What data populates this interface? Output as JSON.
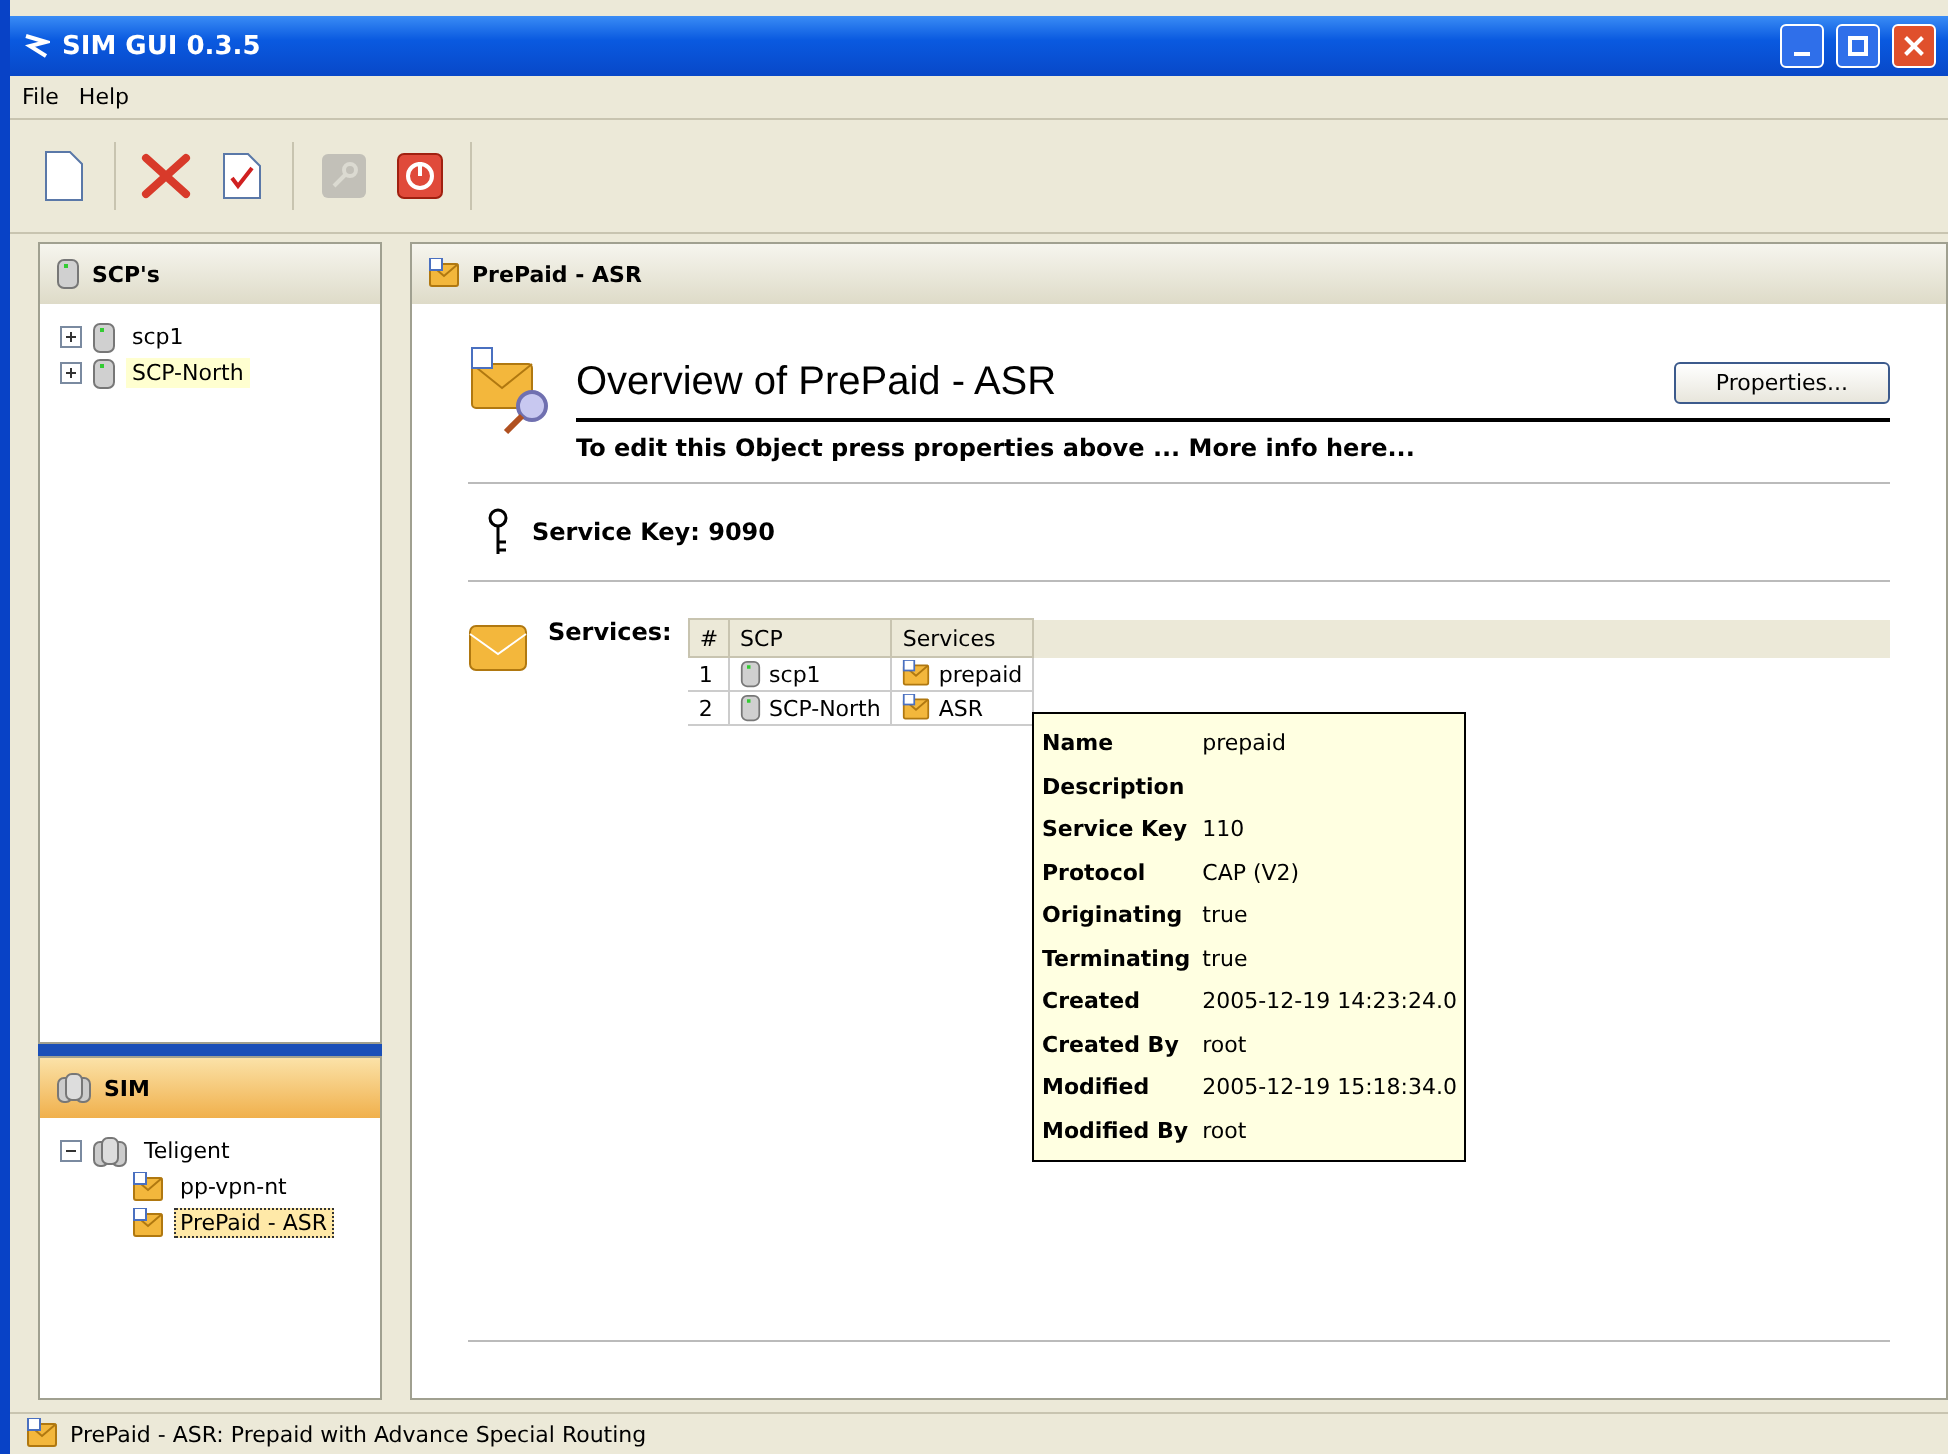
{
  "window": {
    "title": "SIM GUI 0.3.5"
  },
  "menu": [
    "File",
    "Help"
  ],
  "toolbar": [
    {
      "disabled": false
    },
    {
      "disabled": false
    },
    {
      "disabled": false
    },
    {
      "disabled": true
    },
    {
      "disabled": false
    }
  ],
  "scp_panel": {
    "title": "SCP's",
    "items": [
      {
        "label": "scp1",
        "expanded": false,
        "highlighted": false
      },
      {
        "label": "SCP-North",
        "expanded": false,
        "highlighted": true
      }
    ]
  },
  "sim_panel": {
    "title": "SIM",
    "items": [
      {
        "label": "Teligent",
        "expanded": true,
        "selected": false,
        "children": [
          {
            "label": "pp-vpn-nt",
            "selected": false
          },
          {
            "label": "PrePaid - ASR",
            "selected": true
          }
        ]
      }
    ]
  },
  "content": {
    "tab_title": "PrePaid - ASR",
    "heading": "Overview of PrePaid - ASR",
    "properties_button": "Properties...",
    "hint": "To edit this Object press properties above ... More info here...",
    "service_key": "Service Key: 9090",
    "services_label": "Services:",
    "table": {
      "columns": [
        "#",
        "SCP",
        "Services"
      ],
      "rows": [
        [
          "1",
          "scp1",
          "prepaid"
        ],
        [
          "2",
          "SCP-North",
          "ASR"
        ]
      ]
    },
    "tooltip": [
      {
        "key": "Name",
        "value": "prepaid"
      },
      {
        "key": "Description"
      },
      {
        "key": "Service Key",
        "value": "110"
      },
      {
        "key": "Protocol",
        "value": "CAP (V2)"
      },
      {
        "key": "Originating",
        "value": "true"
      },
      {
        "key": "Terminating",
        "value": "true"
      },
      {
        "key": "Created",
        "value": "2005-12-19 14:23:24.0"
      },
      {
        "key": "Created By",
        "value": "root"
      },
      {
        "key": "Modified",
        "value": "2005-12-19 15:18:34.0"
      },
      {
        "key": "Modified By",
        "value": "root"
      }
    ]
  },
  "status_bar": "PrePaid - ASR: Prepaid with Advance Special Routing"
}
